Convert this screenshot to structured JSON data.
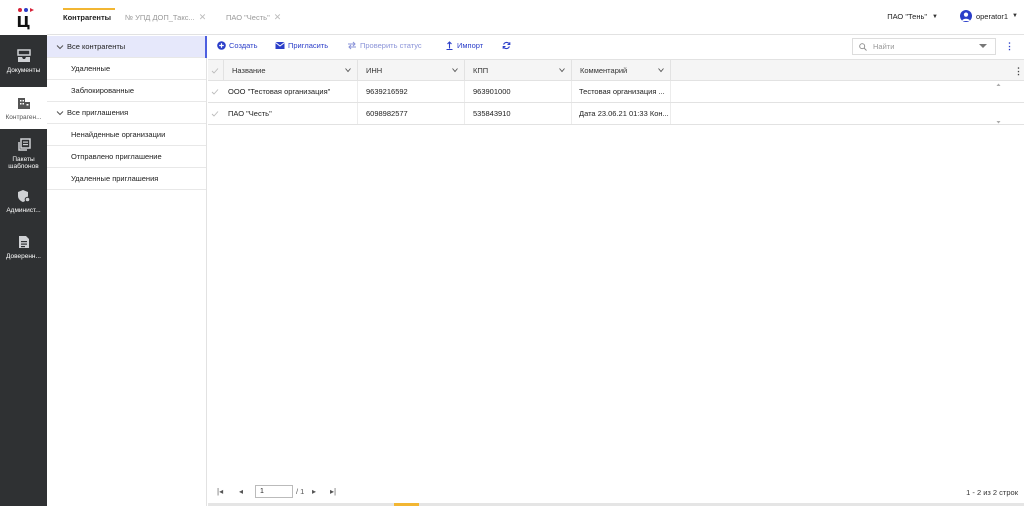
{
  "app": {
    "logo_glyph": "Ц"
  },
  "rail": {
    "items": [
      {
        "label": "Документы",
        "icon": "inbox-icon",
        "active": false
      },
      {
        "label": "Контраген...",
        "icon": "building-icon",
        "active": true
      },
      {
        "label": "Пакеты шаблонов",
        "icon": "stack-icon",
        "active": false
      },
      {
        "label": "Админист...",
        "icon": "shield-gear-icon",
        "active": false
      },
      {
        "label": "Доверенн...",
        "icon": "document-icon",
        "active": false
      }
    ]
  },
  "tabs": [
    {
      "label": "Контрагенты",
      "active": true
    },
    {
      "label": "№ УПД ДОП_Такс...",
      "active": false
    },
    {
      "label": "ПАО \"Честь\"",
      "active": false
    }
  ],
  "header": {
    "org": "ПАО \"Тень\"",
    "user": "operator1"
  },
  "tree": [
    {
      "label": "Все контрагенты",
      "level": 0,
      "expandable": true,
      "selected": true
    },
    {
      "label": "Удаленные",
      "level": 1
    },
    {
      "label": "Заблокированные",
      "level": 1
    },
    {
      "label": "Все приглашения",
      "level": 0,
      "expandable": true
    },
    {
      "label": "Ненайденные организации",
      "level": 1
    },
    {
      "label": "Отправлено приглашение",
      "level": 1
    },
    {
      "label": "Удаленные приглашения",
      "level": 1
    }
  ],
  "toolbar": {
    "create": "Создать",
    "invite": "Пригласить",
    "check_status": "Проверить статус",
    "import": "Импорт",
    "search_placeholder": "Найти"
  },
  "table": {
    "columns": [
      "Название",
      "ИНН",
      "КПП",
      "Комментарий"
    ],
    "rows": [
      [
        "ООО \"Тестовая организация\"",
        "9639216592",
        "963901000",
        "Тестовая организация ..."
      ],
      [
        "ПАО \"Честь\"",
        "6098982577",
        "535843910",
        "Дата 23.06.21 01:33 Кон..."
      ]
    ]
  },
  "pager": {
    "page": "1",
    "total": "/ 1",
    "count": "1 - 2 из 2 строк"
  },
  "colors": {
    "accent": "#2b3ec9",
    "rail": "#2f3133",
    "tab_indicator": "#f2b632",
    "selection": "#e6e8fb"
  }
}
